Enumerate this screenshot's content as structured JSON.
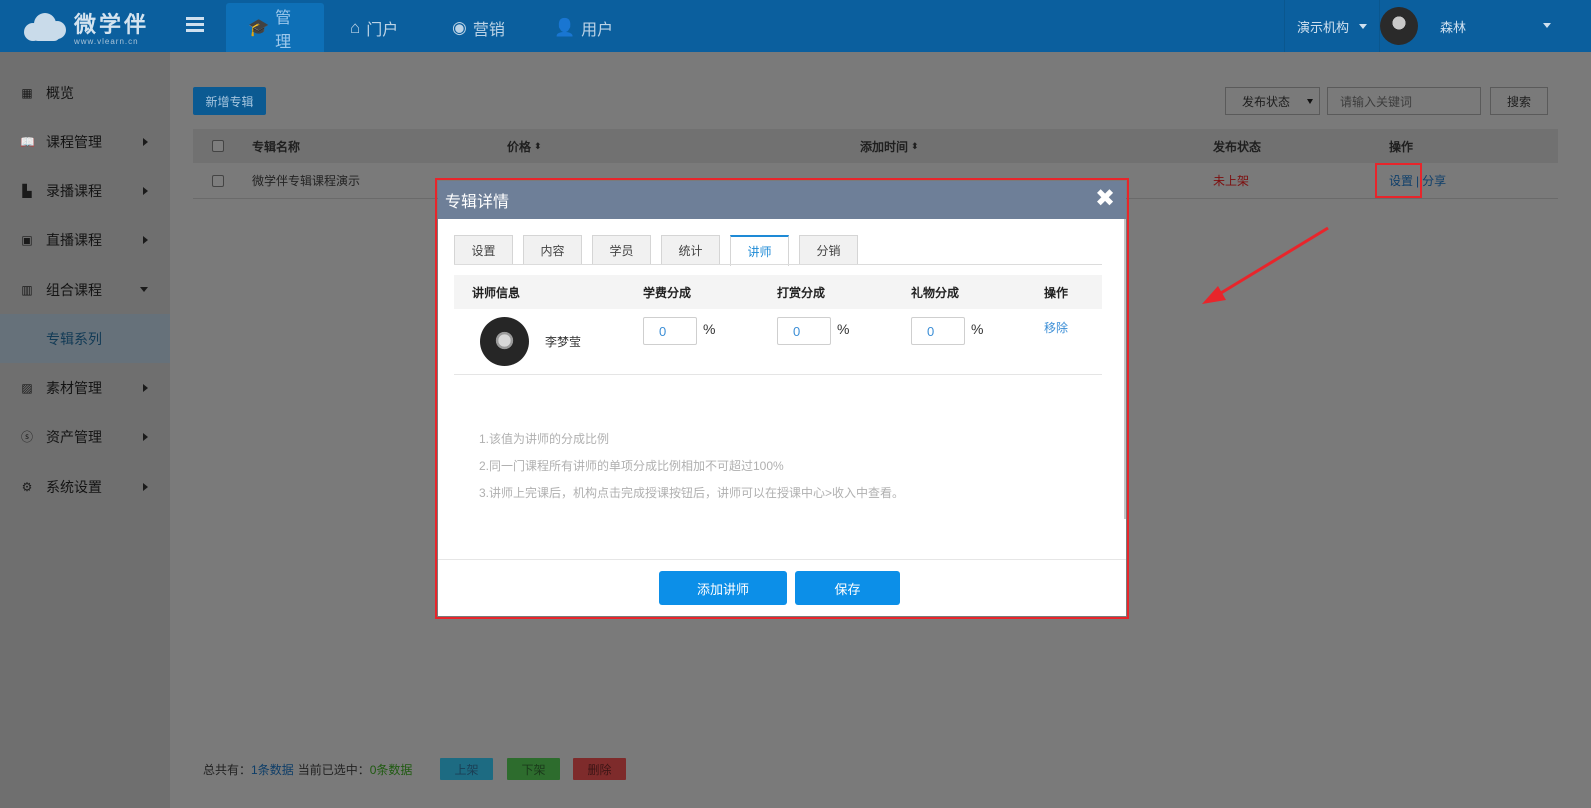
{
  "app": {
    "logo_text": "微学伴",
    "logo_url": "www.vlearn.cn"
  },
  "topnav": {
    "tabs": [
      {
        "label": "管理",
        "icon": "graduation-cap-icon"
      },
      {
        "label": "门户",
        "icon": "home-icon"
      },
      {
        "label": "营销",
        "icon": "target-icon"
      },
      {
        "label": "用户",
        "icon": "user-icon"
      }
    ],
    "org": "演示机构",
    "user": "森林"
  },
  "sidebar": {
    "items": [
      {
        "label": "概览",
        "icon": "grid-icon"
      },
      {
        "label": "课程管理",
        "icon": "book-icon"
      },
      {
        "label": "录播课程",
        "icon": "video-icon"
      },
      {
        "label": "直播课程",
        "icon": "broadcast-icon"
      },
      {
        "label": "组合课程",
        "icon": "bar-chart-icon"
      },
      {
        "label": "专辑系列",
        "icon": ""
      },
      {
        "label": "素材管理",
        "icon": "image-icon"
      },
      {
        "label": "资产管理",
        "icon": "coin-icon"
      },
      {
        "label": "系统设置",
        "icon": "gear-icon"
      }
    ]
  },
  "toolbar": {
    "new_album": "新增专辑",
    "status_select": "发布状态",
    "search_placeholder": "请输入关键词",
    "search_button": "搜索"
  },
  "table": {
    "headers": [
      "专辑名称",
      "价格",
      "添加时间",
      "发布状态",
      "操作"
    ],
    "sort_glyph": "⬍",
    "rows": [
      {
        "name": "微学伴专辑课程演示",
        "status": "未上架",
        "op_settings": "设置",
        "op_sep": "|",
        "op_share": "分享"
      }
    ]
  },
  "footer": {
    "total_label": "总共有：",
    "total_value": "1条数据",
    "selected_label": "当前已选中：",
    "selected_value": "0条数据",
    "btn_publish": "上架",
    "btn_unpublish": "下架",
    "btn_delete": "删除"
  },
  "modal": {
    "title": "专辑详情",
    "close": "✖",
    "tabs": [
      "设置",
      "内容",
      "学员",
      "统计",
      "讲师",
      "分销"
    ],
    "active_tab": "讲师",
    "columns": [
      "讲师信息",
      "学费分成",
      "打赏分成",
      "礼物分成",
      "操作"
    ],
    "lecturer": {
      "name": "李梦莹",
      "tuition_share": "0",
      "tip_share": "0",
      "gift_share": "0",
      "percent": "%",
      "remove": "移除"
    },
    "notes": [
      "1.该值为讲师的分成比例",
      "2.同一门课程所有讲师的单项分成比例相加不可超过100%",
      "3.讲师上完课后，机构点击完成授课按钮后，讲师可以在授课中心>收入中查看。"
    ],
    "btn_add": "添加讲师",
    "btn_save": "保存"
  },
  "colors": {
    "topbar": "#0b5f9e",
    "highlight": "#e8252b",
    "primary_button": "#0c8fe8",
    "modal_header": "#6e7f98"
  }
}
